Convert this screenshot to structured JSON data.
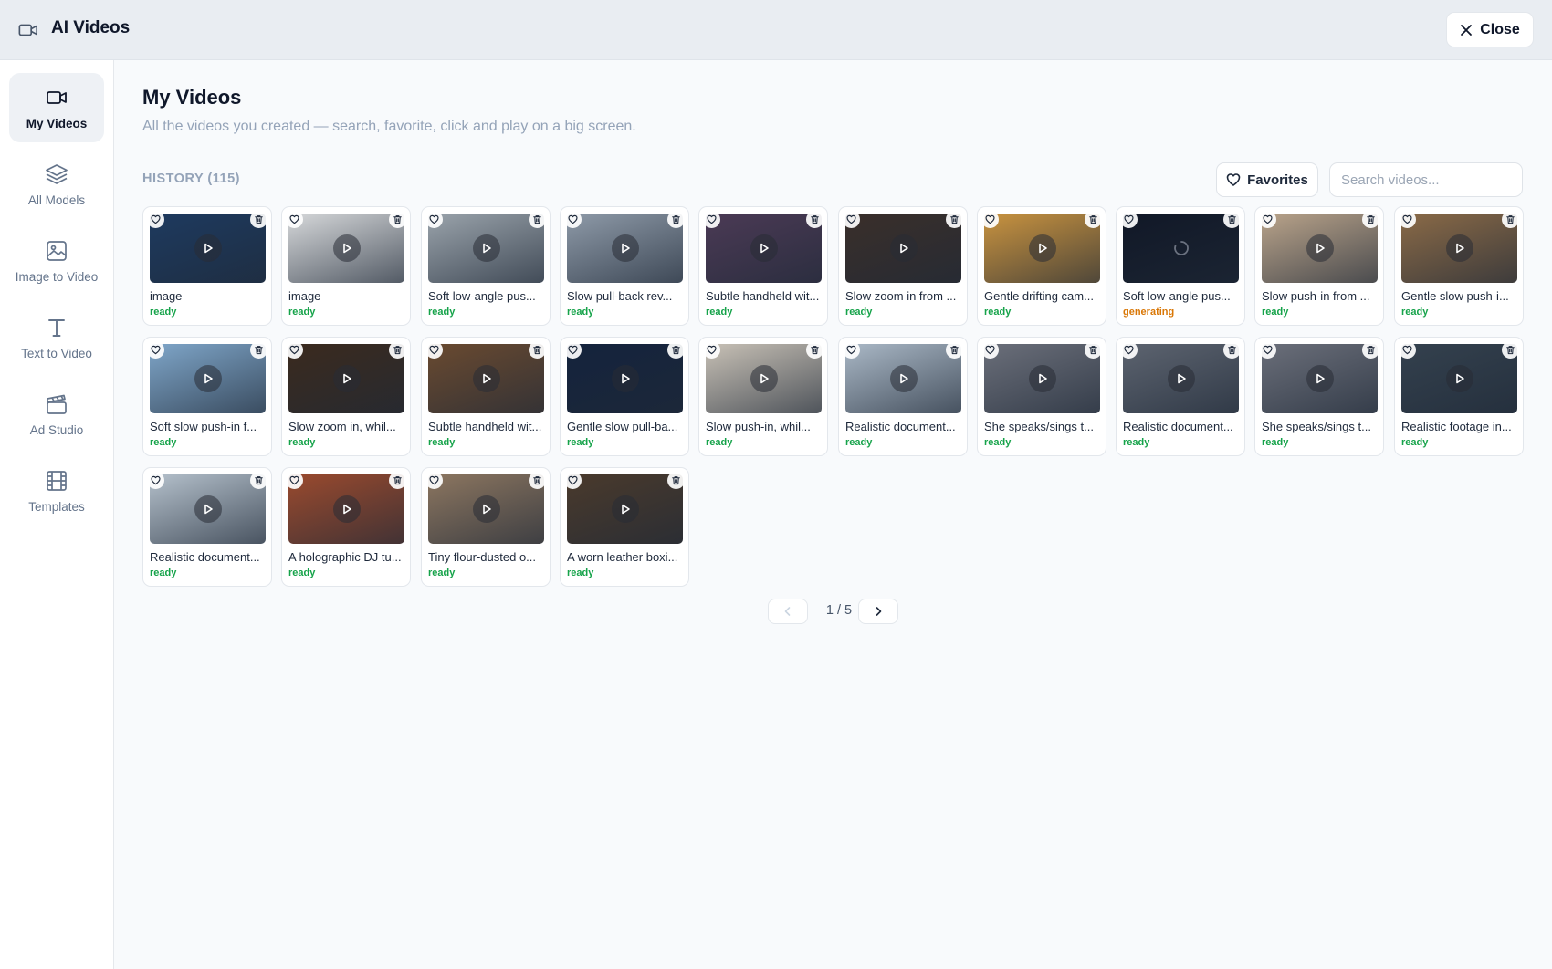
{
  "header": {
    "title": "AI Videos",
    "close_label": "Close"
  },
  "sidebar": {
    "items": [
      {
        "label": "My Videos",
        "icon": "video-camera-icon",
        "active": true
      },
      {
        "label": "All Models",
        "icon": "layers-icon",
        "active": false
      },
      {
        "label": "Image to Video",
        "icon": "image-icon",
        "active": false
      },
      {
        "label": "Text to Video",
        "icon": "text-icon",
        "active": false
      },
      {
        "label": "Ad Studio",
        "icon": "clapperboard-icon",
        "active": false
      },
      {
        "label": "Templates",
        "icon": "film-icon",
        "active": false
      }
    ]
  },
  "main": {
    "title": "My Videos",
    "subtitle": "All the videos you created — search, favorite, click and play on a big screen.",
    "history_label": "HISTORY (115)",
    "favorites_label": "Favorites",
    "search_placeholder": "Search videos..."
  },
  "videos": [
    {
      "title": "image",
      "status": "ready",
      "thumb": "#1e3a5f"
    },
    {
      "title": "image",
      "status": "ready",
      "thumb": "#d6d8da"
    },
    {
      "title": "Soft low-angle pus...",
      "status": "ready",
      "thumb": "#9aa3ab"
    },
    {
      "title": "Slow pull-back rev...",
      "status": "ready",
      "thumb": "#8e9aa8"
    },
    {
      "title": "Subtle handheld wit...",
      "status": "ready",
      "thumb": "#4b3a55"
    },
    {
      "title": "Slow zoom in from ...",
      "status": "ready",
      "thumb": "#3a2f2a"
    },
    {
      "title": "Gentle drifting cam...",
      "status": "ready",
      "thumb": "#c9933f"
    },
    {
      "title": "Soft low-angle pus...",
      "status": "generating",
      "thumb": "#111827"
    },
    {
      "title": "Slow push-in from ...",
      "status": "ready",
      "thumb": "#b9a38a"
    },
    {
      "title": "Gentle slow push-i...",
      "status": "ready",
      "thumb": "#8a6a47"
    },
    {
      "title": "Soft slow push-in f...",
      "status": "ready",
      "thumb": "#7fa6c9"
    },
    {
      "title": "Slow zoom in, whil...",
      "status": "ready",
      "thumb": "#3b2a1e"
    },
    {
      "title": "Subtle handheld wit...",
      "status": "ready",
      "thumb": "#6a4a30"
    },
    {
      "title": "Gentle slow pull-ba...",
      "status": "ready",
      "thumb": "#14233d"
    },
    {
      "title": "Slow push-in, whil...",
      "status": "ready",
      "thumb": "#c8c1b6"
    },
    {
      "title": "Realistic document...",
      "status": "ready",
      "thumb": "#aab8c6"
    },
    {
      "title": "She speaks/sings t...",
      "status": "ready",
      "thumb": "#6b6f7a"
    },
    {
      "title": "Realistic document...",
      "status": "ready",
      "thumb": "#5d6470"
    },
    {
      "title": "She speaks/sings t...",
      "status": "ready",
      "thumb": "#6b6f7a"
    },
    {
      "title": "Realistic footage in...",
      "status": "ready",
      "thumb": "#34414e"
    },
    {
      "title": "Realistic document...",
      "status": "ready",
      "thumb": "#b4c0cb"
    },
    {
      "title": "A holographic DJ tu...",
      "status": "ready",
      "thumb": "#9a4a2e"
    },
    {
      "title": "Tiny flour-dusted o...",
      "status": "ready",
      "thumb": "#8c7660"
    },
    {
      "title": "A worn leather boxi...",
      "status": "ready",
      "thumb": "#4a3a2c"
    }
  ],
  "pagination": {
    "text": "1 / 5"
  }
}
